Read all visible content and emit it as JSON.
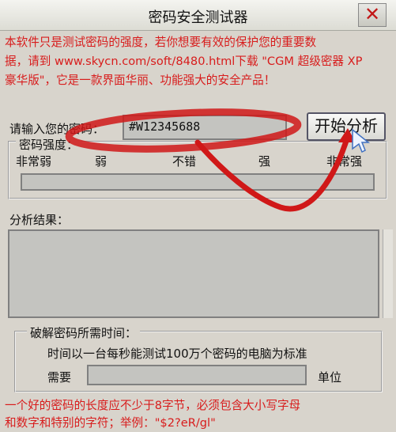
{
  "window": {
    "title": "密码安全测试器",
    "close_glyph": "✕"
  },
  "notice_lines": [
    "本软件只是测试密码的强度，若你想要有效的保护您的重要数",
    "据，请到 www.skycn.com/soft/8480.html下载 \"CGM 超级密器 XP",
    "豪华版\"，它是一款界面华丽、功能强大的安全产品！"
  ],
  "password": {
    "label": "请输入您的密码：",
    "value": "#W12345688"
  },
  "analyze_button": "开始分析",
  "strength": {
    "title": "密码强度：",
    "levels": [
      "非常弱",
      "弱",
      "不错",
      "强",
      "非常强"
    ]
  },
  "results": {
    "title": "分析结果："
  },
  "crack": {
    "title": "破解密码所需时间：",
    "desc": "时间以一台每秒能测试100万个密码的电脑为标准",
    "need_label": "需要",
    "unit_label": "单位"
  },
  "tip_lines": [
    "一个好的密码的长度应不少于8字节，必须包含大小写字母",
    "和数字和特别的字符；举例：\"$2?eR/gl\""
  ],
  "colors": {
    "notice": "#d81c1c",
    "arrow": "#d01818"
  }
}
